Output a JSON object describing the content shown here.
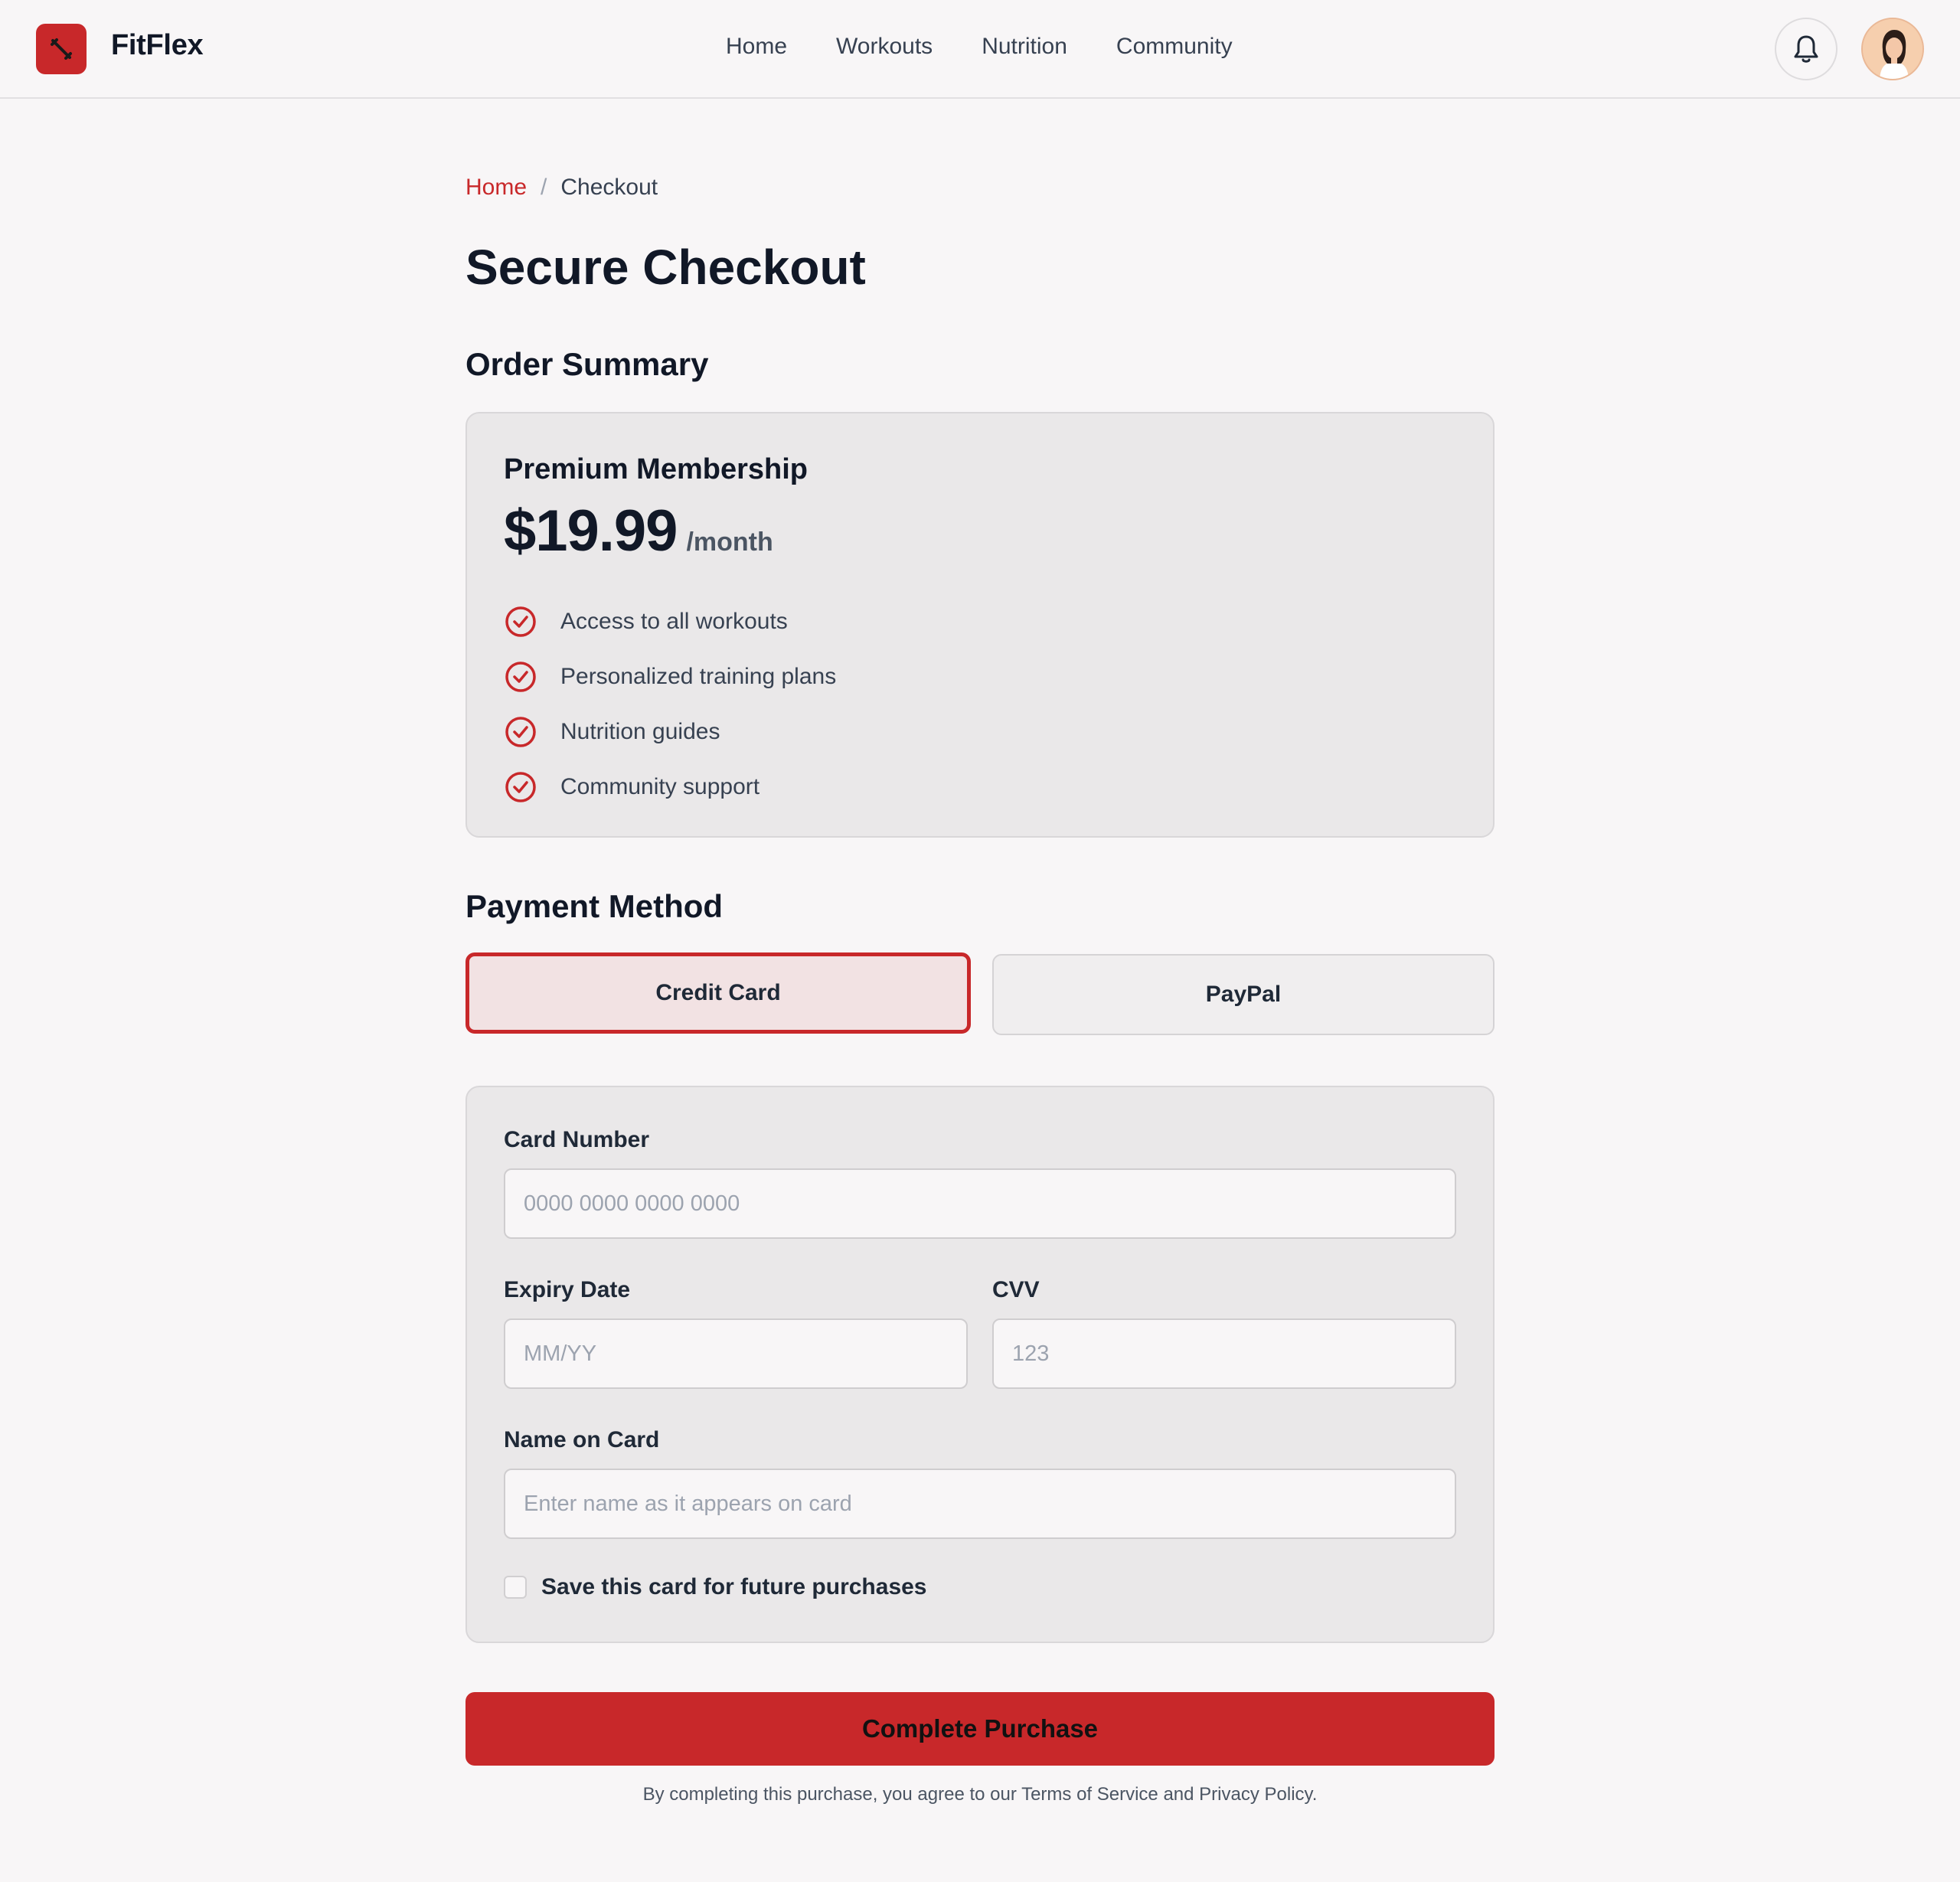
{
  "header": {
    "brand": "FitFlex",
    "nav": [
      "Home",
      "Workouts",
      "Nutrition",
      "Community"
    ]
  },
  "breadcrumb": {
    "home": "Home",
    "separator": "/",
    "current": "Checkout"
  },
  "page_title": "Secure Checkout",
  "order_summary": {
    "title": "Order Summary",
    "plan": "Premium Membership",
    "price": "$19.99",
    "period": "/month",
    "features": [
      "Access to all workouts",
      "Personalized training plans",
      "Nutrition guides",
      "Community support"
    ]
  },
  "payment": {
    "title": "Payment Method",
    "methods": [
      "Credit Card",
      "PayPal"
    ],
    "selected": "Credit Card",
    "card_number": {
      "label": "Card Number",
      "placeholder": "0000 0000 0000 0000"
    },
    "expiry": {
      "label": "Expiry Date",
      "placeholder": "MM/YY"
    },
    "cvv": {
      "label": "CVV",
      "placeholder": "123"
    },
    "name": {
      "label": "Name on Card",
      "placeholder": "Enter name as it appears on card"
    },
    "save_card": "Save this card for future purchases"
  },
  "submit_label": "Complete Purchase",
  "legal": "By completing this purchase, you agree to our Terms of Service and Privacy Policy.",
  "colors": {
    "accent": "#c8282a",
    "background": "#f8f6f7",
    "card": "#eae8e9"
  }
}
